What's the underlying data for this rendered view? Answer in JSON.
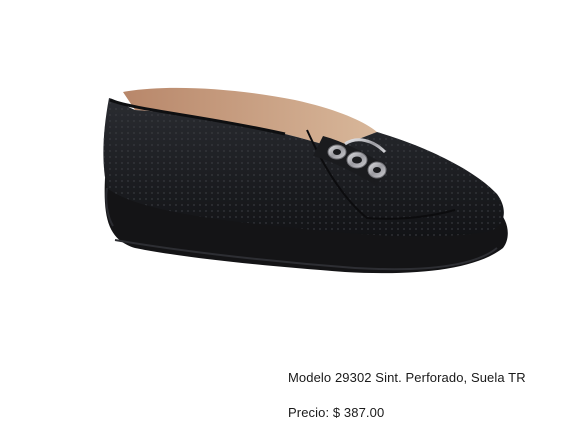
{
  "product": {
    "model_line": "Modelo 29302 Sint. Perforado, Suela TR",
    "price_line": "Precio: $ 387.00",
    "image_icon": "black-perforated-wedge-loafer-with-silver-chain-ornament",
    "colors": {
      "upper": "#1b1c1f",
      "sole": "#141416",
      "lining": "#c9a180",
      "ornament": "#b9b9bc"
    }
  }
}
